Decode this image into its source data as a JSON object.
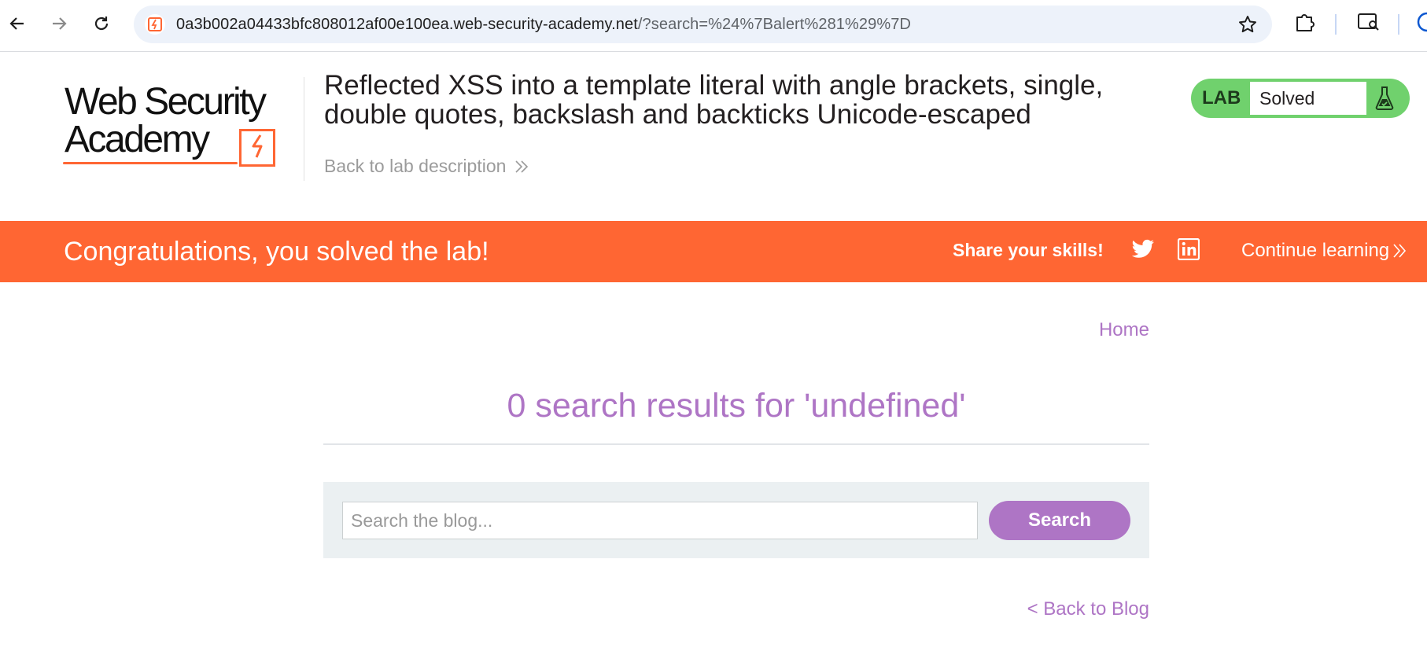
{
  "browser": {
    "url_host": "0a3b002a04433bfc808012af00e100ea.web-security-academy.net",
    "url_path": "/?search=%24%7Balert%281%29%7D",
    "back_icon": "arrow-left-icon",
    "forward_icon": "arrow-right-icon",
    "reload_icon": "reload-icon",
    "bookmark_icon": "star-icon",
    "extensions_icon": "puzzle-icon"
  },
  "header": {
    "logo_line1": "Web Security",
    "logo_line2": "Academy",
    "lab_title": "Reflected XSS into a template literal with angle brackets, single, double quotes, backslash and backticks Unicode-escaped",
    "back_to_description": "Back to lab description",
    "badge": {
      "label": "LAB",
      "status": "Solved",
      "color": "#70d16d"
    }
  },
  "banner": {
    "message": "Congratulations, you solved the lab!",
    "share_label": "Share your skills!",
    "continue_label": "Continue learning",
    "color": "#ff6633"
  },
  "nav": {
    "home_label": "Home"
  },
  "results": {
    "title": "0 search results for 'undefined'"
  },
  "search": {
    "placeholder": "Search the blog...",
    "value": "",
    "button_label": "Search",
    "accent": "#ae75c5"
  },
  "footer": {
    "back_to_blog": "< Back to Blog"
  }
}
